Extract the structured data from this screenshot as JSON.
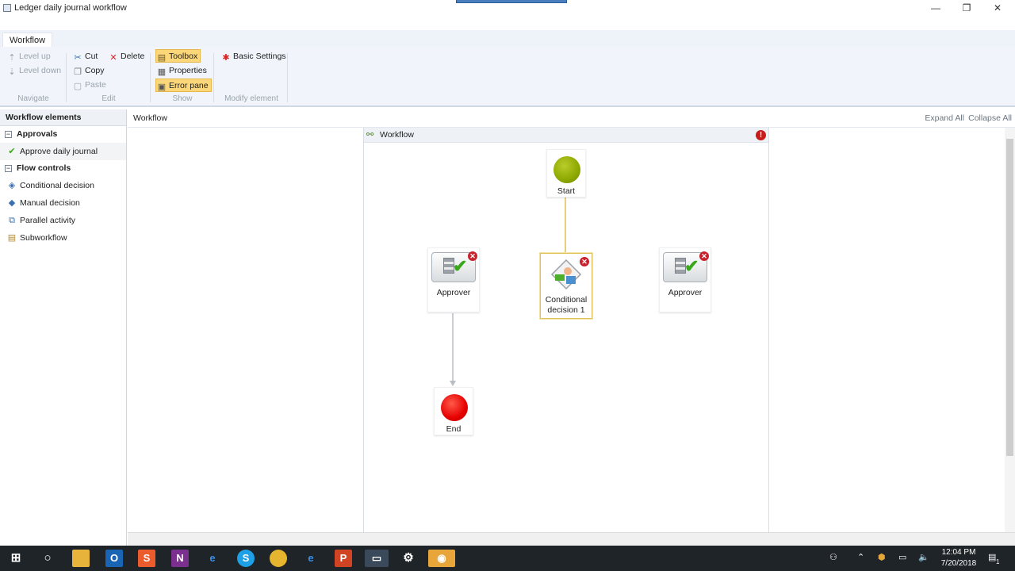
{
  "window": {
    "title": "Ledger daily journal workflow",
    "minimize": "—",
    "restore": "❐",
    "close": "✕"
  },
  "ribbon": {
    "tab": "Workflow",
    "navigate": {
      "label": "Navigate",
      "level_up": "Level up",
      "level_down": "Level down"
    },
    "edit": {
      "label": "Edit",
      "cut": "Cut",
      "delete": "Delete",
      "copy": "Copy",
      "paste": "Paste"
    },
    "show": {
      "label": "Show",
      "toolbox": "Toolbox",
      "properties": "Properties",
      "error_pane": "Error pane"
    },
    "modify": {
      "label": "Modify element",
      "basic_settings": "Basic Settings"
    }
  },
  "left_panel": {
    "header": "Workflow elements",
    "categories": [
      {
        "label": "Approvals",
        "items": [
          "Approve daily journal"
        ]
      },
      {
        "label": "Flow controls",
        "items": [
          "Conditional decision",
          "Manual decision",
          "Parallel activity",
          "Subworkflow"
        ]
      }
    ]
  },
  "main": {
    "breadcrumb": "Workflow",
    "expand_all": "Expand All",
    "collapse_all": "Collapse All",
    "workflow_title": "Workflow",
    "error_indicator": "!"
  },
  "nodes": {
    "start": "Start",
    "end": "End",
    "approver_left": "Approver",
    "conditional": "Conditional decision 1",
    "approver_right": "Approver"
  },
  "taskbar": {
    "time": "12:04 PM",
    "date": "7/20/2018",
    "notification_count": "1"
  },
  "colors": {
    "start": "#8da800",
    "end": "#e60000",
    "accent": "#fbd77a",
    "error": "#c81b1b"
  }
}
